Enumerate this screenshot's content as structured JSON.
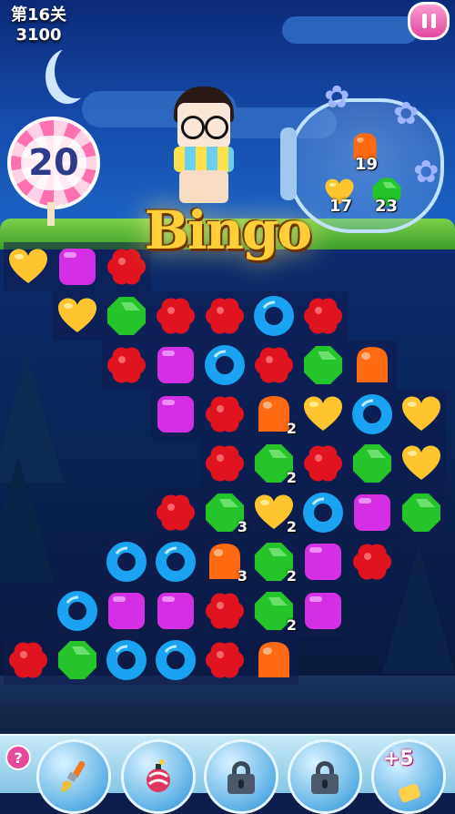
{
  "header": {
    "level_label": "第16关",
    "score": "3100"
  },
  "moves_left": "20",
  "bingo_text": "Bingo",
  "goals": [
    {
      "candy": "orange-jelly",
      "count": "19"
    },
    {
      "candy": "yellow-heart",
      "count": "17"
    },
    {
      "candy": "green-octagon",
      "count": "23"
    }
  ],
  "colors": {
    "red": "#e0141e",
    "orange": "#ff6a12",
    "yellow": "#ffc52e",
    "green": "#25c42a",
    "blue": "#1aa3f0",
    "purple": "#d52fe3"
  },
  "board": [
    [
      "yellow-heart",
      "purple-square",
      "red-flower",
      null,
      null,
      null,
      null,
      null,
      null
    ],
    [
      null,
      "yellow-heart",
      "green-octagon",
      "red-flower",
      "red-flower",
      "blue-ring",
      "red-flower",
      null,
      null
    ],
    [
      null,
      null,
      "red-flower",
      "purple-square",
      "blue-ring",
      "red-flower",
      "green-octagon",
      "orange-jelly",
      null
    ],
    [
      null,
      null,
      null,
      "purple-square",
      "red-flower",
      "orange-jelly",
      "yellow-heart",
      "blue-ring",
      "yellow-heart"
    ],
    [
      null,
      null,
      null,
      null,
      "red-flower",
      "green-octagon",
      "red-flower",
      "green-octagon",
      "yellow-heart"
    ],
    [
      null,
      null,
      null,
      "red-flower",
      "green-octagon",
      "yellow-heart",
      "blue-ring",
      "purple-square",
      "green-octagon"
    ],
    [
      null,
      null,
      "blue-ring",
      "blue-ring",
      "orange-jelly",
      "green-octagon",
      "purple-square",
      "red-flower",
      null
    ],
    [
      null,
      "blue-ring",
      "purple-square",
      "purple-square",
      "red-flower",
      "green-octagon",
      "purple-square",
      null,
      null
    ],
    [
      "red-flower",
      "green-octagon",
      "blue-ring",
      "blue-ring",
      "red-flower",
      "orange-jelly",
      null,
      null,
      null
    ]
  ],
  "badges": [
    {
      "row": 3,
      "col": 5,
      "text": "2"
    },
    {
      "row": 4,
      "col": 5,
      "text": "2"
    },
    {
      "row": 5,
      "col": 4,
      "text": "3"
    },
    {
      "row": 5,
      "col": 5,
      "text": "2"
    },
    {
      "row": 6,
      "col": 4,
      "text": "3"
    },
    {
      "row": 6,
      "col": 5,
      "text": "2"
    },
    {
      "row": 7,
      "col": 5,
      "text": "2"
    }
  ],
  "boosters": [
    {
      "name": "paintbrush-booster",
      "icon": "paintbrush-icon",
      "locked": false
    },
    {
      "name": "bomb-candy-booster",
      "icon": "bomb-candy-icon",
      "locked": false
    },
    {
      "name": "locked-booster-1",
      "icon": "lock-icon",
      "locked": true
    },
    {
      "name": "locked-booster-2",
      "icon": "lock-icon",
      "locked": true
    },
    {
      "name": "plus-moves-booster",
      "icon": "plus-five-icon",
      "locked": false,
      "label": "+5"
    }
  ],
  "help_label": "?"
}
